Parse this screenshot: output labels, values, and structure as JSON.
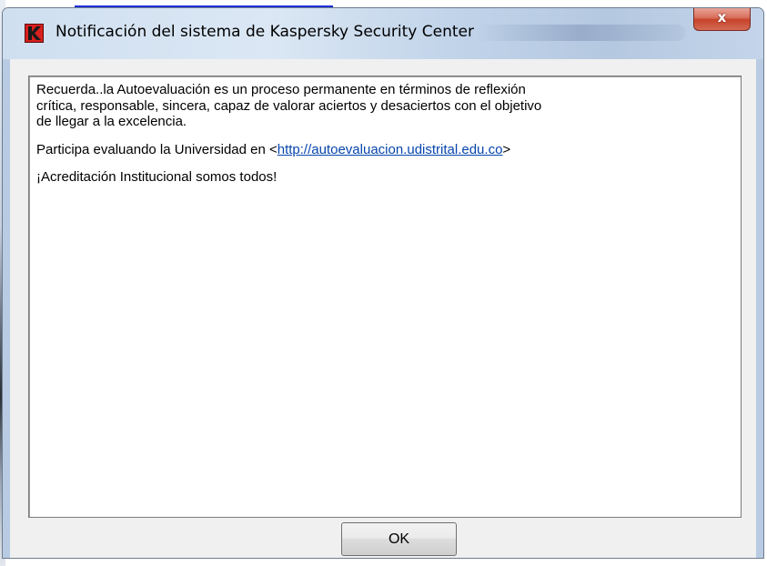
{
  "window": {
    "title": "Notificación del sistema de Kaspersky Security Center",
    "close_glyph": "x",
    "icon": "kaspersky-k-icon"
  },
  "message": {
    "paragraph1": [
      "Recuerda..la Autoevaluación es un proceso permanente en términos de reflexión",
      "crítica, responsable, sincera, capaz de valorar aciertos y desaciertos con el objetivo",
      " de llegar a la excelencia."
    ],
    "participa_prefix": "Participa evaluando la Universidad en <",
    "link_text": "http://autoevaluacion.udistrital.edu.co",
    "participa_suffix": ">",
    "closing": "¡Acreditación Institucional somos todos!"
  },
  "buttons": {
    "ok_label": "OK"
  },
  "colors": {
    "link": "#0645ad",
    "close_button": "#c7442b",
    "icon_red": "#d8201e"
  }
}
